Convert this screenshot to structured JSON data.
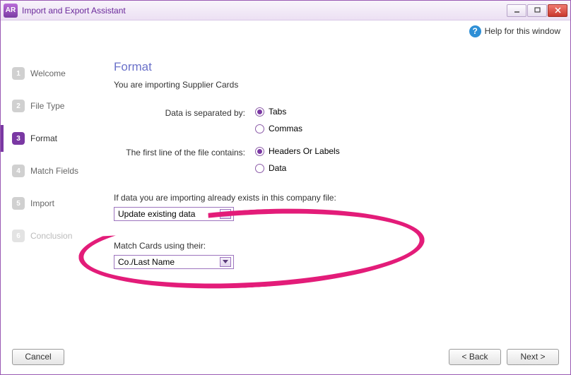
{
  "window": {
    "title": "Import and Export Assistant",
    "app_abbrev": "AR"
  },
  "help": {
    "label": "Help for this window"
  },
  "steps": [
    {
      "num": "1",
      "label": "Welcome"
    },
    {
      "num": "2",
      "label": "File Type"
    },
    {
      "num": "3",
      "label": "Format"
    },
    {
      "num": "4",
      "label": "Match Fields"
    },
    {
      "num": "5",
      "label": "Import"
    },
    {
      "num": "6",
      "label": "Conclusion"
    }
  ],
  "content": {
    "heading": "Format",
    "subtitle": "You are importing Supplier Cards",
    "separator": {
      "label": "Data is separated by:",
      "options": [
        "Tabs",
        "Commas"
      ],
      "selected": "Tabs"
    },
    "firstline": {
      "label": "The first line of the file contains:",
      "options": [
        "Headers Or Labels",
        "Data"
      ],
      "selected": "Headers Or Labels"
    },
    "exists": {
      "label": "If data you are importing already exists in this company file:",
      "value": "Update existing data"
    },
    "match": {
      "label": "Match Cards using their:",
      "value": "Co./Last Name"
    }
  },
  "footer": {
    "cancel": "Cancel",
    "back": "< Back",
    "next": "Next >"
  }
}
